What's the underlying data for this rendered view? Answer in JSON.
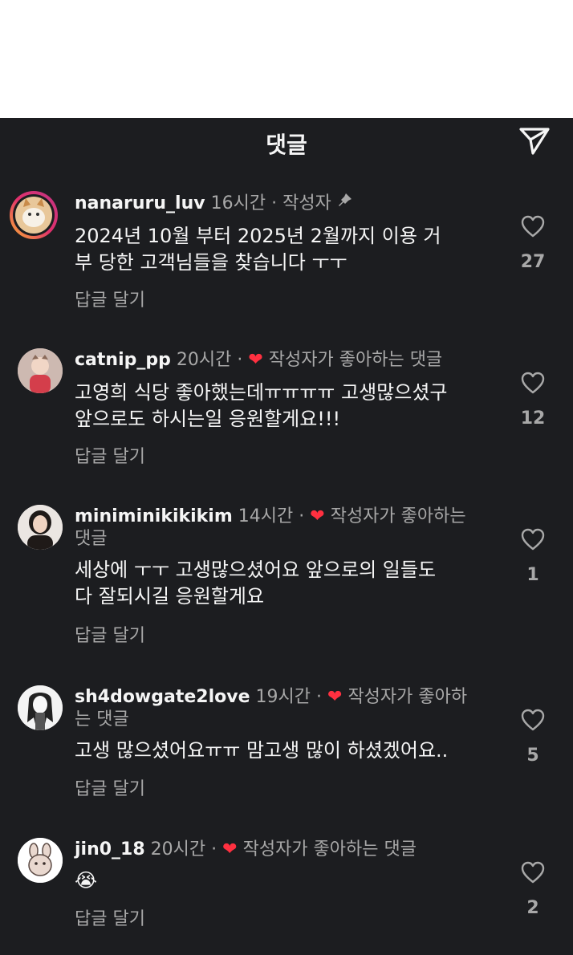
{
  "header": {
    "title": "댓글",
    "share_icon": "paper-plane-icon"
  },
  "colors": {
    "background": "#1c1d20",
    "text": "#f5f5f5",
    "muted": "#a8a8a8",
    "heart": "#ff3040"
  },
  "comments": [
    {
      "username": "nanaruru_luv",
      "time": "16시간",
      "separator": "·",
      "badge": "작성자",
      "pinned": true,
      "text_lines": [
        "2024년 10월 부터 2025년 2월까지 이용 거",
        "부 당한 고객님들을 찾습니다 ㅜㅜ"
      ],
      "reply": "답글 달기",
      "likes": "27"
    },
    {
      "username": "catnip_pp",
      "time": "20시간",
      "separator": "·",
      "liked_by_author": "작성자가 좋아하는 댓글",
      "text_lines": [
        "고영희 식당 좋아했는데ㅠㅠㅠㅠ 고생많으셨구",
        "앞으로도 하시는일 응원할게요!!!"
      ],
      "reply": "답글 달기",
      "likes": "12"
    },
    {
      "username": "miniminikikikim",
      "time": "14시간",
      "separator": "·",
      "liked_by_author_1": "작성자가 좋아하는",
      "liked_by_author_2": "댓글",
      "text_lines": [
        "세상에 ㅜㅜ 고생많으셨어요 앞으로의 일들도",
        "다 잘되시길 응원할게요"
      ],
      "reply": "답글 달기",
      "likes": "1"
    },
    {
      "username": "sh4dowgate2love",
      "time": "19시간",
      "separator": "·",
      "liked_by_author_1": "작성자가 좋아하",
      "liked_by_author_2": "는 댓글",
      "text_lines": [
        "고생 많으셨어요ㅠㅠ 맘고생 많이 하셨겠어요.."
      ],
      "reply": "답글 달기",
      "likes": "5"
    },
    {
      "username": "jin0_18",
      "time": "20시간",
      "separator": "·",
      "liked_by_author": "작성자가 좋아하는 댓글",
      "text_lines": [
        "😭"
      ],
      "reply": "답글 달기",
      "likes": "2"
    }
  ]
}
